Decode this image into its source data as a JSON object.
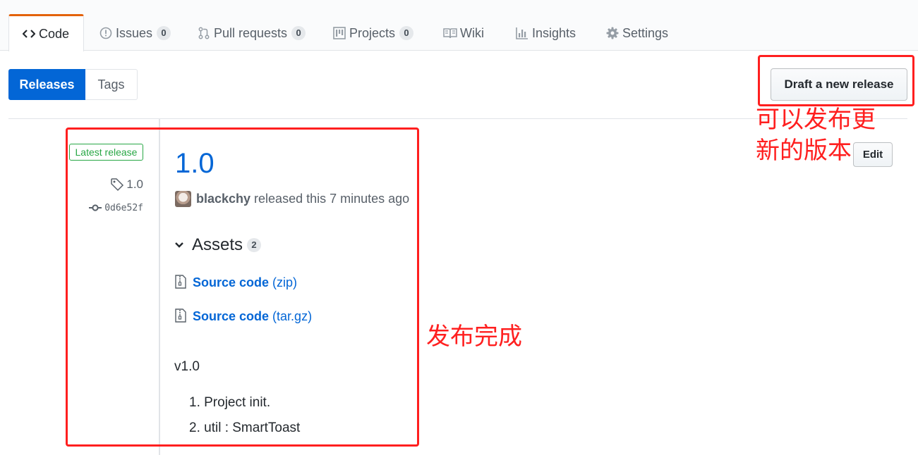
{
  "nav": {
    "tabs": [
      {
        "label": "Code",
        "icon": "code-icon",
        "selected": true
      },
      {
        "label": "Issues",
        "icon": "issue-icon",
        "count": "0"
      },
      {
        "label": "Pull requests",
        "icon": "pull-request-icon",
        "count": "0"
      },
      {
        "label": "Projects",
        "icon": "project-icon",
        "count": "0"
      },
      {
        "label": "Wiki",
        "icon": "book-icon"
      },
      {
        "label": "Insights",
        "icon": "graph-icon"
      },
      {
        "label": "Settings",
        "icon": "gear-icon"
      }
    ]
  },
  "subnav": {
    "releases": "Releases",
    "tags": "Tags"
  },
  "actions": {
    "draft": "Draft a new release",
    "edit": "Edit"
  },
  "release": {
    "latest_label": "Latest release",
    "tag": "1.0",
    "commit": "0d6e52f",
    "title": "1.0",
    "author": "blackchy",
    "released_text": "released this 7 minutes ago",
    "assets_label": "Assets",
    "assets_count": "2",
    "assets": [
      {
        "name": "Source code",
        "ext": "(zip)"
      },
      {
        "name": "Source code",
        "ext": "(tar.gz)"
      }
    ],
    "description": "v1.0",
    "notes": [
      "1. Project init.",
      "2. util : SmartToast"
    ]
  },
  "annotations": {
    "draft_note_line1": "可以发布更",
    "draft_note_line2": "新的版本",
    "done_note": "发布完成",
    "color": "#ff1f1f"
  },
  "colors": {
    "accent": "#0366d6",
    "tab_indicator": "#e36209",
    "latest_green": "#28a745"
  }
}
